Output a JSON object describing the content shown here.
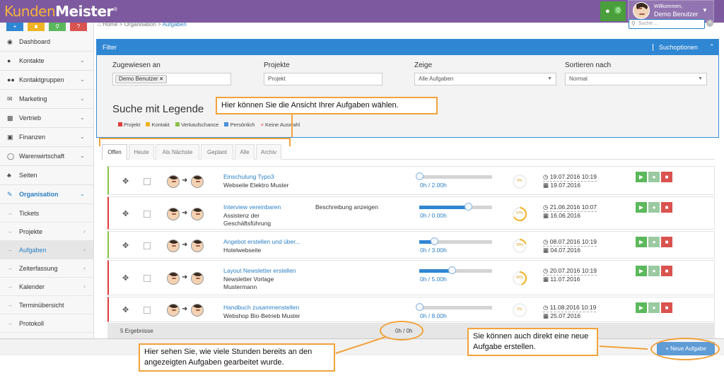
{
  "header": {
    "logo_part1": "Kunden",
    "logo_part2": "Meister",
    "logo_mark": "®",
    "messages_count": "0",
    "welcome": "Willkommen,",
    "user_name": "Demo Benutzer"
  },
  "colors": {
    "header_bg": "#7d5a9f",
    "accent_blue": "#2f86d3",
    "callout_orange": "#f2a23a",
    "legend_projekt": "#e03b3b",
    "legend_kontakt": "#f0b323",
    "legend_verkaufschance": "#8cc14a",
    "legend_persoenlich": "#4a90d9",
    "legend_keine": "#e03b3b"
  },
  "sidebar": {
    "items": [
      {
        "label": "Dashboard",
        "icon": "dashboard-icon"
      },
      {
        "label": "Kontakte",
        "icon": "user-icon"
      },
      {
        "label": "Kontaktgruppen",
        "icon": "users-icon"
      },
      {
        "label": "Marketing",
        "icon": "envelope-icon"
      },
      {
        "label": "Vertrieb",
        "icon": "chart-icon"
      },
      {
        "label": "Finanzen",
        "icon": "money-icon"
      },
      {
        "label": "Warenwirtschaft",
        "icon": "globe-icon"
      },
      {
        "label": "Seiten",
        "icon": "sitemap-icon"
      },
      {
        "label": "Organisation",
        "icon": "edit-icon"
      }
    ],
    "sub_items": [
      {
        "label": "Tickets"
      },
      {
        "label": "Projekte"
      },
      {
        "label": "Aufgaben"
      },
      {
        "label": "Zeiterfassung"
      },
      {
        "label": "Kalender"
      },
      {
        "label": "Terminübersicht"
      },
      {
        "label": "Protokoll"
      }
    ]
  },
  "breadcrumb": {
    "home": "Home",
    "sep": ">",
    "level1": "Organisation",
    "current": "Aufgaben"
  },
  "search": {
    "placeholder": "Suche ..."
  },
  "filter": {
    "title": "Filter",
    "options_label": "Suchoptionen",
    "assigned_label": "Zugewiesen an",
    "assigned_tag": "Demo Benutzer",
    "projects_label": "Projekte",
    "projects_placeholder": "Projekt",
    "show_label": "Zeige",
    "show_value": "Alle Aufgaben",
    "sort_label": "Sortieren nach",
    "sort_value": "Normal",
    "legend_title": "Suche mit Legende",
    "legend": [
      "Projekt",
      "Kontakt",
      "Verkaufschance",
      "Persönlich",
      "Keine Auswahl"
    ]
  },
  "tabs": [
    "Offen",
    "Heute",
    "Als Nächste",
    "Geplant",
    "Alle",
    "Archiv"
  ],
  "tasks": [
    {
      "title": "Einschulung Typo3",
      "sub": "Webseite Elektro Muster",
      "desc": "",
      "progress": 0.0,
      "hours": "0h / 2.00h",
      "pct": "0%",
      "percent_value": 0,
      "date1": "19.07.2016 10:19",
      "date2": "19.07.2016",
      "stripe": "#8cc14a"
    },
    {
      "title": "Interview vereinbaren",
      "sub": "Assistenz der Geschäftsführung",
      "desc": "Beschreibung anzeigen",
      "progress": 0.67,
      "hours": "0h / 0.00h",
      "pct": "67%",
      "percent_value": 67,
      "date1": "21.06.2016 10:07",
      "date2": "16.06.2016",
      "stripe": "#e03b3b"
    },
    {
      "title": "Angebot erstellen und über...",
      "sub": "Hotelwebseite",
      "desc": "",
      "progress": 0.2,
      "hours": "0h / 3.00h",
      "pct": "20%",
      "percent_value": 20,
      "date1": "08.07.2016 10:19",
      "date2": "04.07.2016",
      "stripe": "#8cc14a"
    },
    {
      "title": "Layout Newsletter erstellen",
      "sub": "Newsletter Vorlage Mustermann",
      "desc": "",
      "progress": 0.45,
      "hours": "0h / 5.00h",
      "pct": "45%",
      "percent_value": 45,
      "date1": "20.07.2016 10:19",
      "date2": "11.07.2016",
      "stripe": "#e03b3b"
    },
    {
      "title": "Handbuch zusammenstellen",
      "sub": "Webshop Bio-Betrieb Muster",
      "desc": "",
      "progress": 0.0,
      "hours": "0h / 8.00h",
      "pct": "0%",
      "percent_value": 0,
      "date1": "11.08.2016 10:19",
      "date2": "25.07.2016",
      "stripe": "#e03b3b"
    }
  ],
  "footer": {
    "count": "5 Ergebnisse",
    "sum": "0h / 0h"
  },
  "new_task_label": "+ Neue Aufgabe",
  "callouts": {
    "tabs": "Hier können Sie die Ansicht Ihrer Aufgaben wählen.",
    "hours": "Hier sehen Sie, wie viele Stunden bereits an den angezeigten Aufgaben gearbeitet wurde.",
    "new": "Sie können auch direkt eine neue Aufgabe erstellen."
  }
}
